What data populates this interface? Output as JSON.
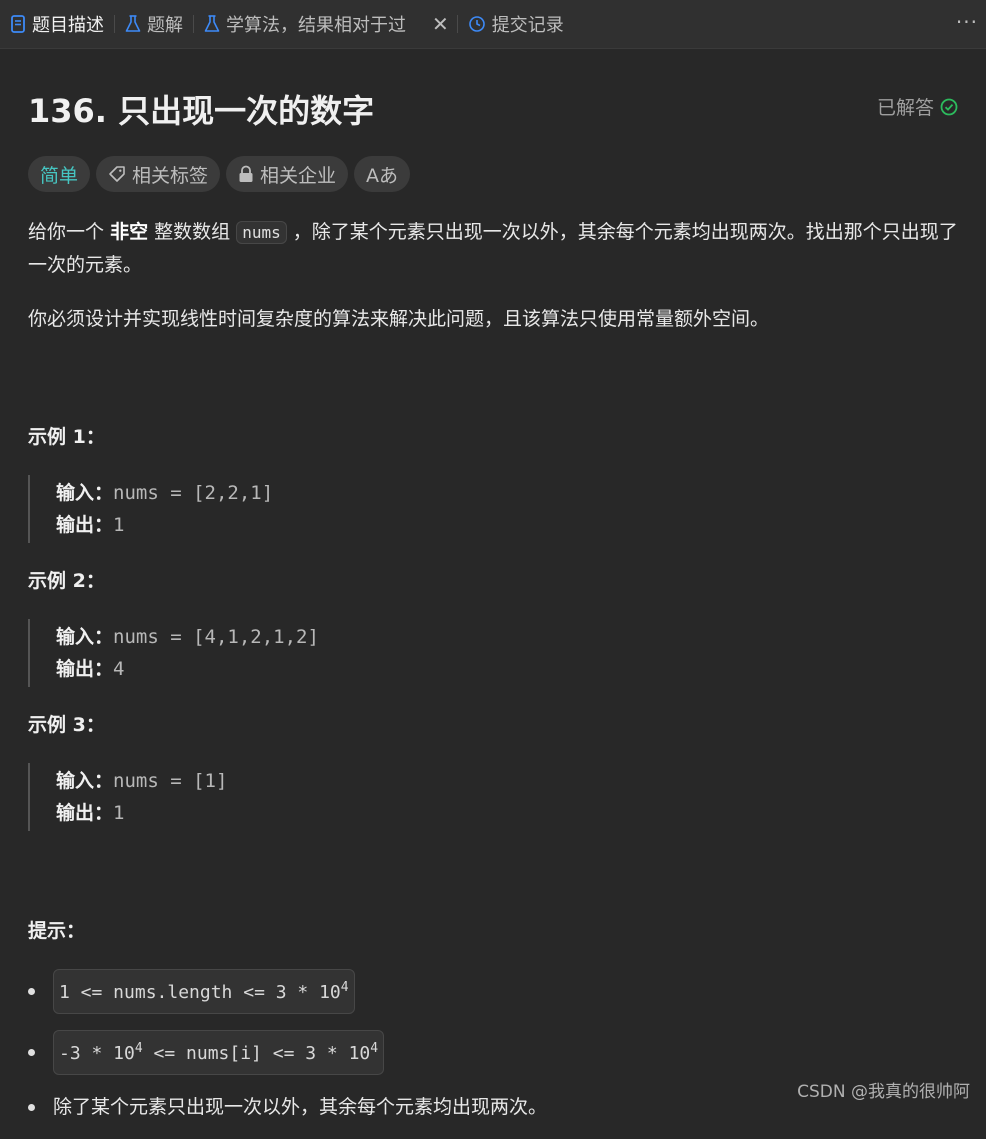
{
  "tabs": {
    "description": "题目描述",
    "solutions": "题解",
    "editorial": "学算法，结果相对于过",
    "submissions": "提交记录",
    "more": "···"
  },
  "problem": {
    "title": "136. 只出现一次的数字",
    "status": "已解答",
    "tags": {
      "difficulty": "简单",
      "related_tags": "相关标签",
      "related_companies": "相关企业",
      "translate": "Aあ"
    },
    "desc": {
      "p1_a": "给你一个",
      "p1_strong": "非空",
      "p1_b": "整数数组",
      "p1_code": "nums",
      "p1_c": "，除了某个元素只出现一次以外，其余每个元素均出现两次。找出那个只出现了一次的元素。",
      "p2": "你必须设计并实现线性时间复杂度的算法来解决此问题，且该算法只使用常量额外空间。"
    },
    "examples": [
      {
        "title": "示例 1：",
        "input_label": "输入：",
        "input": "nums = [2,2,1]",
        "output_label": "输出：",
        "output": "1"
      },
      {
        "title": "示例 2：",
        "input_label": "输入：",
        "input": "nums = [4,1,2,1,2]",
        "output_label": "输出：",
        "output": "4"
      },
      {
        "title": "示例 3：",
        "input_label": "输入：",
        "input": "nums = [1]",
        "output_label": "输出：",
        "output": "1"
      }
    ],
    "hint_title": "提示：",
    "constraints": {
      "c1_a": "1 <= nums.length <= 3 * 10",
      "c1_sup": "4",
      "c2_a": "-3 * 10",
      "c2_sup1": "4",
      "c2_b": " <= nums[i] <= 3 * 10",
      "c2_sup2": "4",
      "c3": "除了某个元素只出现一次以外，其余每个元素均出现两次。"
    }
  },
  "watermark": "CSDN @我真的很帅阿",
  "colors": {
    "easy": "#46c6c2",
    "solved_check": "#2cbb5d",
    "tab_icon_blue": "#3d8af7"
  }
}
